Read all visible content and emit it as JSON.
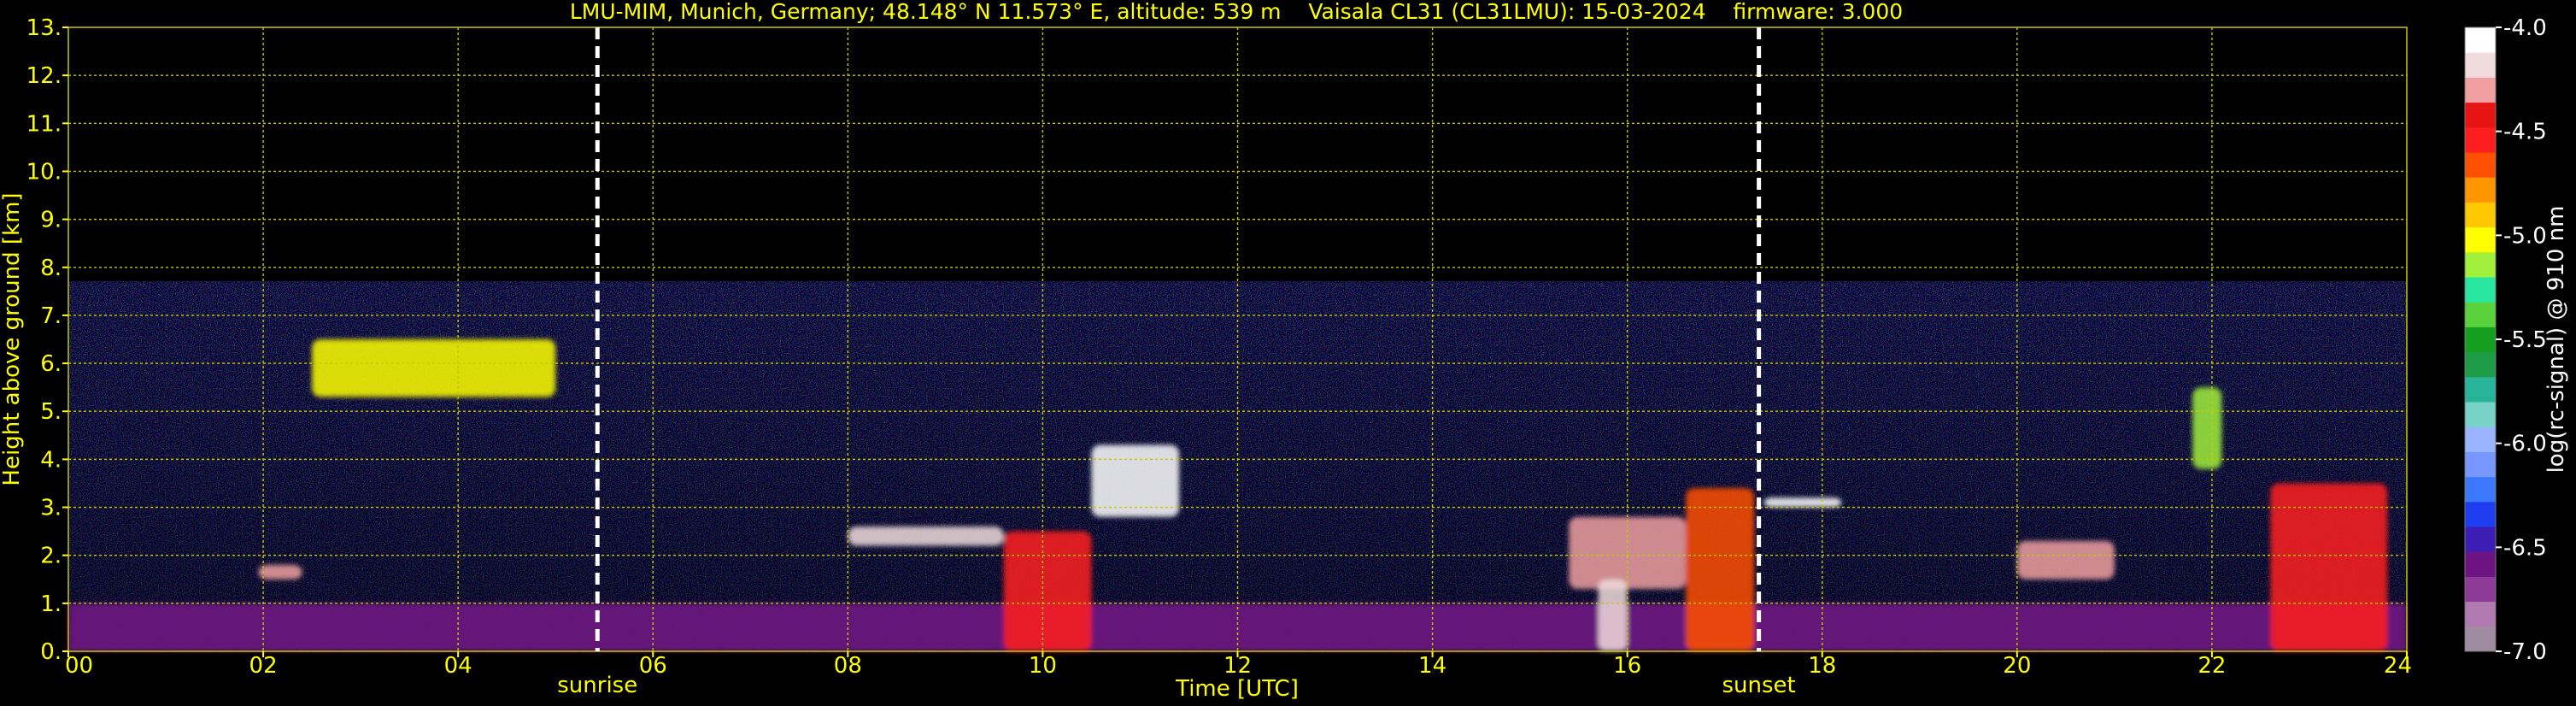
{
  "chart_data": {
    "type": "heatmap",
    "title": "LMU-MIM, Munich, Germany; 48.148° N 11.573° E, altitude: 539 m    Vaisala CL31 (CL31LMU): 15-03-2024    firmware: 3.000",
    "xlabel": "Time [UTC]",
    "ylabel": "Height above ground [km]",
    "xlim": [
      0,
      24
    ],
    "ylim": [
      0,
      13
    ],
    "x_ticks": [
      "00",
      "02",
      "04",
      "06",
      "08",
      "10",
      "12",
      "14",
      "16",
      "18",
      "20",
      "22",
      "24"
    ],
    "y_ticks": [
      "0.",
      "1.",
      "2.",
      "3.",
      "4.",
      "5.",
      "6.",
      "7.",
      "8.",
      "9.",
      "10.",
      "11.",
      "12.",
      "13."
    ],
    "grid": true,
    "colorbar": {
      "label": "log(rc-signal) @ 910 nm",
      "range": [
        -7.0,
        -4.0
      ],
      "ticks": [
        "-4.0",
        "-4.5",
        "-5.0",
        "-5.5",
        "-6.0",
        "-6.5",
        "-7.0"
      ],
      "colors": [
        "#a08ca0",
        "#b07ab0",
        "#8c3c96",
        "#6e1482",
        "#3c1eb4",
        "#1e3cf0",
        "#3c78ff",
        "#7896ff",
        "#9bb4ff",
        "#78d2c8",
        "#28b49b",
        "#1e9b46",
        "#14a01e",
        "#5ad23c",
        "#28e6a0",
        "#a0f03c",
        "#ffff00",
        "#ffc800",
        "#ff9600",
        "#ff5000",
        "#ff1e1e",
        "#e61414",
        "#f0a0a0",
        "#f0dcdc",
        "#ffffff"
      ]
    },
    "events": [
      {
        "label": "sunrise",
        "x": 5.43
      },
      {
        "label": "sunset",
        "x": 17.35
      }
    ],
    "features": [
      {
        "kind": "aerosol-layer",
        "x": [
          0,
          24
        ],
        "y": [
          0,
          1.0
        ],
        "value": -6.6
      },
      {
        "kind": "cloud",
        "x": [
          2.5,
          5.0
        ],
        "y": [
          5.3,
          6.5
        ],
        "value": -5.0
      },
      {
        "kind": "cloud",
        "x": [
          1.95,
          2.4
        ],
        "y": [
          1.5,
          1.8
        ],
        "value": -4.3
      },
      {
        "kind": "cloud",
        "x": [
          8.0,
          9.6
        ],
        "y": [
          2.2,
          2.6
        ],
        "value": -4.2
      },
      {
        "kind": "cloud",
        "x": [
          10.5,
          11.4
        ],
        "y": [
          2.8,
          4.3
        ],
        "value": -4.1
      },
      {
        "kind": "convection",
        "x": [
          9.6,
          10.5
        ],
        "y": [
          0,
          2.5
        ],
        "value": -4.6
      },
      {
        "kind": "cloud",
        "x": [
          15.4,
          16.6
        ],
        "y": [
          1.3,
          2.8
        ],
        "value": -4.3
      },
      {
        "kind": "convection",
        "x": [
          15.7,
          16.0
        ],
        "y": [
          0,
          1.5
        ],
        "value": -4.2
      },
      {
        "kind": "convection",
        "x": [
          16.6,
          17.3
        ],
        "y": [
          0,
          3.4
        ],
        "value": -4.7
      },
      {
        "kind": "cloud",
        "x": [
          17.4,
          18.2
        ],
        "y": [
          3.0,
          3.2
        ],
        "value": -4.1
      },
      {
        "kind": "cloud",
        "x": [
          21.8,
          22.1
        ],
        "y": [
          3.8,
          5.5
        ],
        "value": -5.1
      },
      {
        "kind": "convection",
        "x": [
          22.6,
          23.8
        ],
        "y": [
          0,
          3.5
        ],
        "value": -4.6
      },
      {
        "kind": "cloud",
        "x": [
          20.0,
          21.0
        ],
        "y": [
          1.5,
          2.3
        ],
        "value": -4.3
      }
    ]
  }
}
